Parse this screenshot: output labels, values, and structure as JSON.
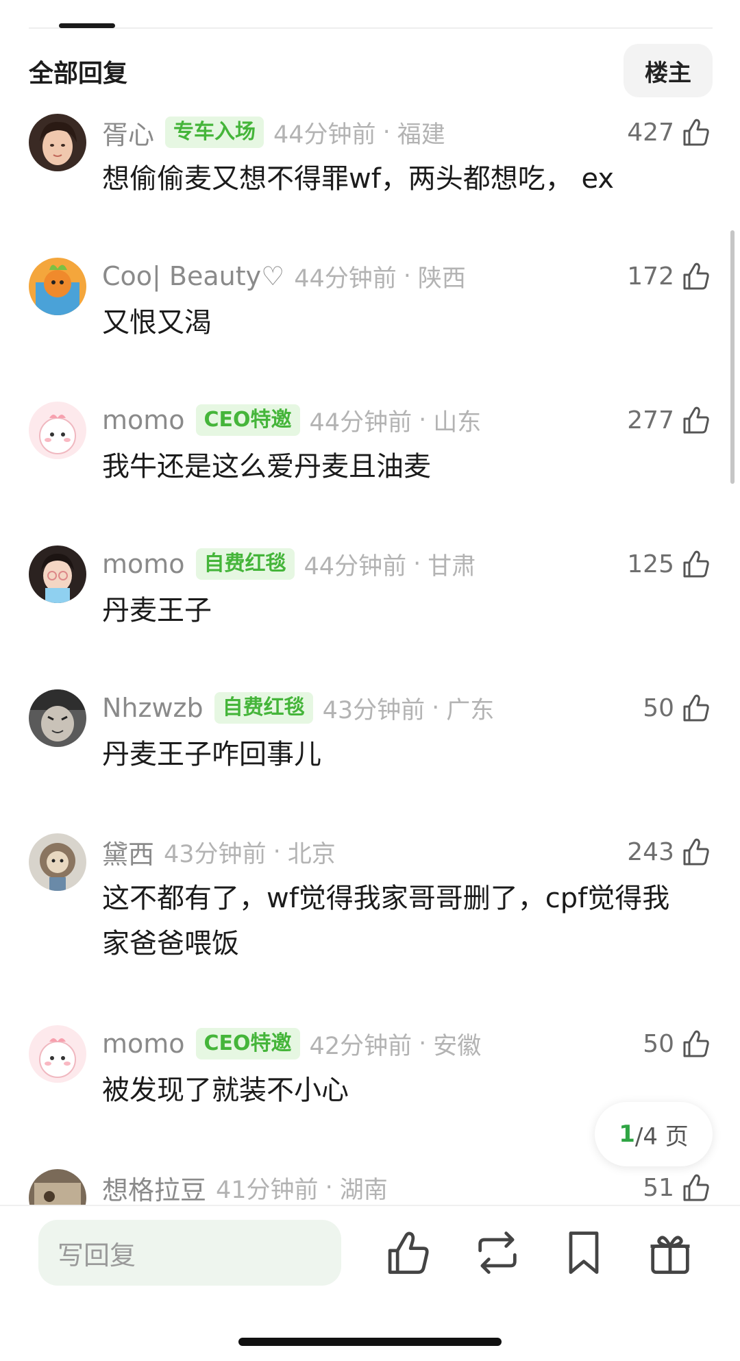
{
  "header": {
    "section_title": "全部回复",
    "op_button_label": "楼主"
  },
  "comments": [
    {
      "username": "胥心",
      "badge": "专车入场",
      "time": "44分钟前",
      "separator": "·",
      "region": "福建",
      "likes": "427",
      "text": "想偷偷麦又想不得罪wf，两头都想吃， ex"
    },
    {
      "username": "Coo| Beauty♡",
      "badge": "",
      "time": "44分钟前",
      "separator": "·",
      "region": "陕西",
      "likes": "172",
      "text": "又恨又渴"
    },
    {
      "username": "momo",
      "badge": "CEO特邀",
      "time": "44分钟前",
      "separator": "·",
      "region": "山东",
      "likes": "277",
      "text": "我牛还是这么爱丹麦且油麦"
    },
    {
      "username": "momo",
      "badge": "自费红毯",
      "time": "44分钟前",
      "separator": "·",
      "region": "甘肃",
      "likes": "125",
      "text": "丹麦王子"
    },
    {
      "username": "Nhzwzb",
      "badge": "自费红毯",
      "time": "43分钟前",
      "separator": "·",
      "region": "广东",
      "likes": "50",
      "text": "丹麦王子咋回事儿"
    },
    {
      "username": "黛西",
      "badge": "",
      "time": "43分钟前",
      "separator": "·",
      "region": "北京",
      "likes": "243",
      "text": "这不都有了，wf觉得我家哥哥删了，cpf觉得我家爸爸喂饭"
    },
    {
      "username": "momo",
      "badge": "CEO特邀",
      "time": "42分钟前",
      "separator": "·",
      "region": "安徽",
      "likes": "50",
      "text": "被发现了就装不小心"
    },
    {
      "username": "想格拉豆",
      "badge": "",
      "time": "41分钟前",
      "separator": "·",
      "region": "湖南",
      "likes": "51",
      "text": ""
    }
  ],
  "pagination": {
    "current": "1",
    "rest": "/4 页"
  },
  "bottom_bar": {
    "reply_placeholder": "写回复",
    "icons": [
      "thumbs-up-icon",
      "repost-icon",
      "bookmark-icon",
      "gift-icon"
    ]
  },
  "colors": {
    "badge_text": "#45b53a",
    "badge_bg": "#e6f7e2",
    "page_current": "#2fa544",
    "input_bg": "#eef5ee"
  }
}
